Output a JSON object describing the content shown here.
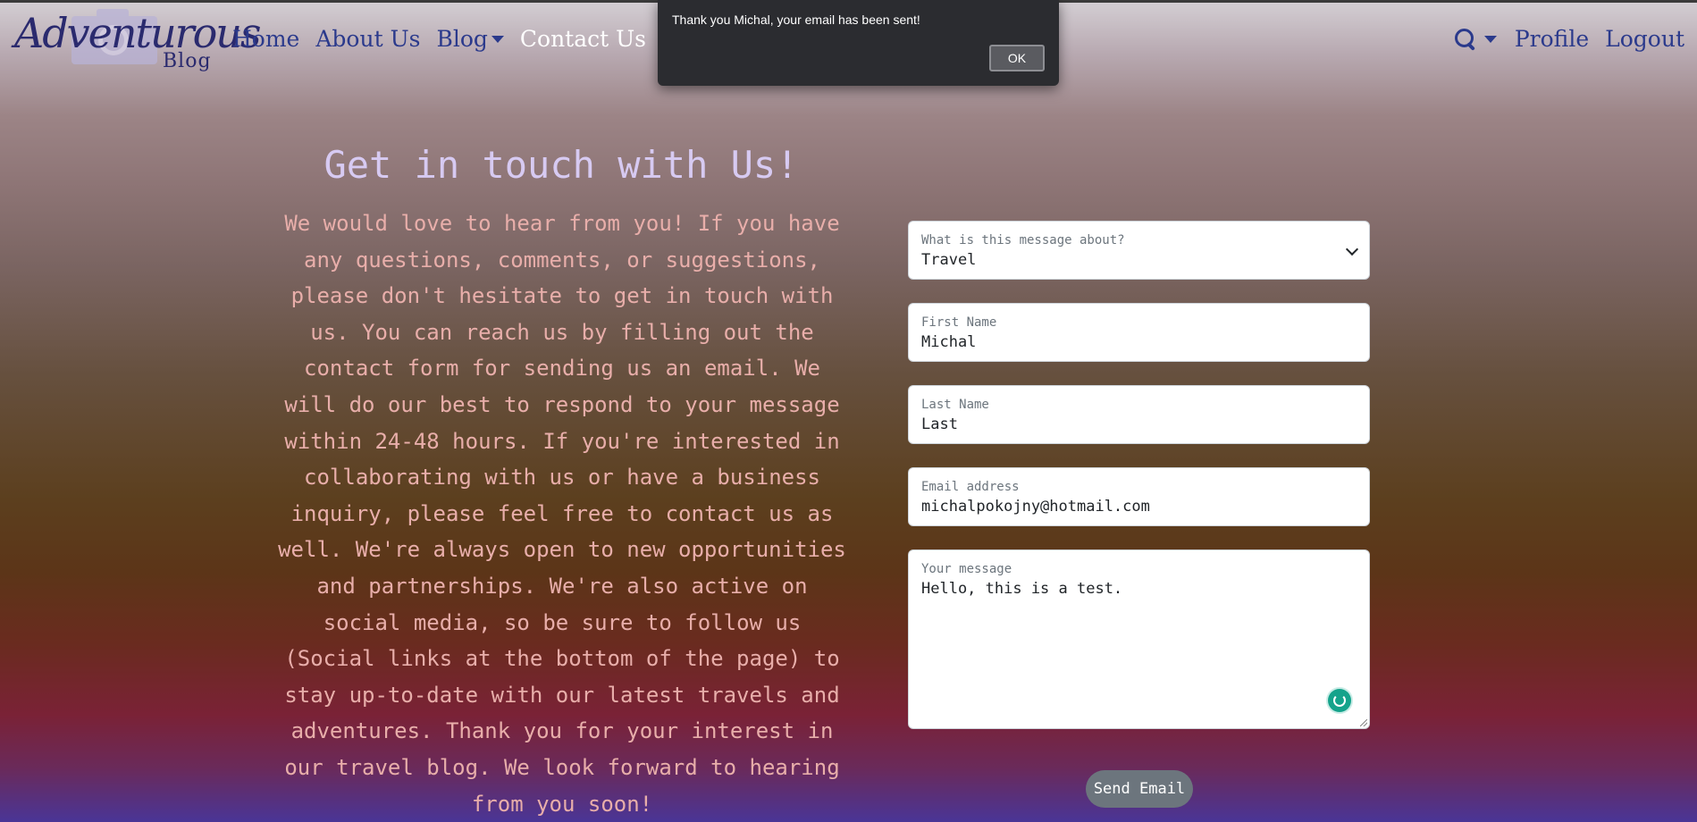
{
  "brand": {
    "name": "Adventurous",
    "sub": "Blog"
  },
  "nav": {
    "items": [
      {
        "label": "Home"
      },
      {
        "label": "About Us"
      },
      {
        "label": "Blog"
      },
      {
        "label": "Contact Us"
      }
    ],
    "profile": "Profile",
    "logout": "Logout"
  },
  "alert": {
    "message": "Thank you Michal, your email has been sent!",
    "ok_label": "OK"
  },
  "contact": {
    "heading": "Get in touch with Us!",
    "intro": "We would love to hear from you! If you have any questions, comments, or suggestions, please don't hesitate to get in touch with us. You can reach us by filling out the contact form for sending us an email. We will do our best to respond to your message within 24-48 hours. If you're interested in collaborating with us or have a business inquiry, please feel free to contact us as well. We're always open to new opportunities and partnerships. We're also active on social media, so be sure to follow us (Social links at the bottom of the page) to stay up-to-date with our latest travels and adventures. Thank you for your interest in our travel blog. We look forward to hearing from you soon!"
  },
  "form": {
    "topic": {
      "label": "What is this message about?",
      "value": "Travel"
    },
    "first_name": {
      "label": "First Name",
      "value": "Michal"
    },
    "last_name": {
      "label": "Last Name",
      "value": "Last"
    },
    "email": {
      "label": "Email address",
      "value": "michalpokojny@hotmail.com"
    },
    "message": {
      "label": "Your message",
      "value": "Hello, this is a test."
    },
    "submit_label": "Send Email"
  }
}
